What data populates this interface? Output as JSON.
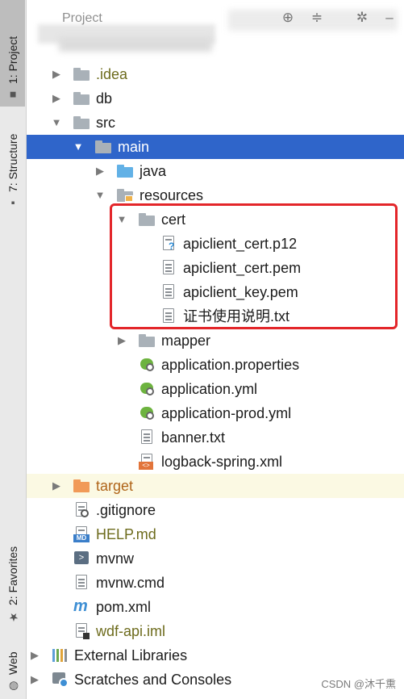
{
  "header": {
    "title": "Project",
    "icons": [
      "target-icon",
      "collapse-icon",
      "gear-icon",
      "minimize-icon"
    ]
  },
  "sidebar": {
    "tabs": [
      {
        "name": "project",
        "label": "1: Project"
      },
      {
        "name": "structure",
        "label": "7: Structure"
      },
      {
        "name": "favorites",
        "label": "2: Favorites"
      },
      {
        "name": "web",
        "label": "Web"
      }
    ]
  },
  "tree": {
    "items": [
      {
        "label": ".idea",
        "icon": "folder-gray-icon",
        "expanded": false,
        "color": "olive"
      },
      {
        "label": "db",
        "icon": "folder-gray-icon",
        "expanded": false
      },
      {
        "label": "src",
        "icon": "folder-gray-icon",
        "expanded": true
      },
      {
        "label": "main",
        "icon": "folder-gray-icon",
        "expanded": true,
        "selected": true
      },
      {
        "label": "java",
        "icon": "folder-blue-icon",
        "expanded": false
      },
      {
        "label": "resources",
        "icon": "folder-resources-icon",
        "expanded": true
      },
      {
        "label": "cert",
        "icon": "folder-gray-icon",
        "expanded": true
      },
      {
        "label": "apiclient_cert.p12",
        "icon": "unknown-file-icon"
      },
      {
        "label": "apiclient_cert.pem",
        "icon": "text-file-icon"
      },
      {
        "label": "apiclient_key.pem",
        "icon": "text-file-icon"
      },
      {
        "label": "证书使用说明.txt",
        "icon": "text-file-icon"
      },
      {
        "label": "mapper",
        "icon": "folder-gray-icon",
        "expanded": false
      },
      {
        "label": "application.properties",
        "icon": "spring-config-icon"
      },
      {
        "label": "application.yml",
        "icon": "spring-config-icon"
      },
      {
        "label": "application-prod.yml",
        "icon": "spring-config-icon"
      },
      {
        "label": "banner.txt",
        "icon": "text-file-icon"
      },
      {
        "label": "logback-spring.xml",
        "icon": "xml-file-icon"
      },
      {
        "label": "target",
        "icon": "folder-orange-icon",
        "expanded": false,
        "color": "orange"
      },
      {
        "label": ".gitignore",
        "icon": "ignore-file-icon"
      },
      {
        "label": "HELP.md",
        "icon": "markdown-file-icon",
        "color": "olive"
      },
      {
        "label": "mvnw",
        "icon": "shell-script-icon"
      },
      {
        "label": "mvnw.cmd",
        "icon": "text-file-icon"
      },
      {
        "label": "pom.xml",
        "icon": "maven-icon"
      },
      {
        "label": "wdf-api.iml",
        "icon": "module-file-icon",
        "color": "olive"
      },
      {
        "label": "External Libraries",
        "icon": "libraries-icon",
        "expanded": false
      },
      {
        "label": "Scratches and Consoles",
        "icon": "scratches-icon",
        "expanded": false
      }
    ]
  },
  "highlight": {
    "color": "#e3262a"
  },
  "watermark": "CSDN @沐千熏",
  "colors": {
    "selection": "#2f65ca",
    "excluded_bg": "#fbf9e3",
    "olive_text": "#6d6b1c",
    "orange_text": "#b0651a"
  }
}
